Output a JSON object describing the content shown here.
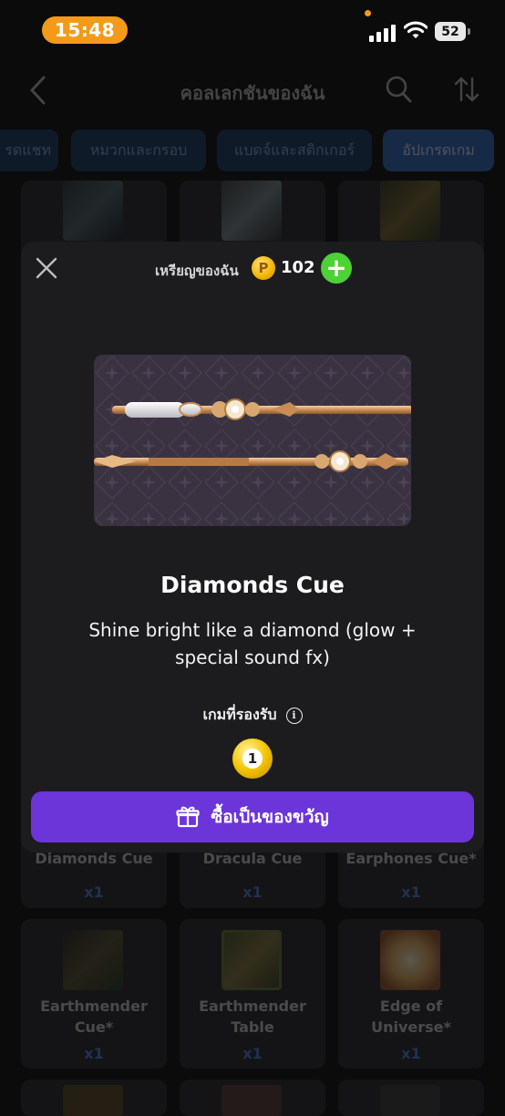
{
  "status_bar": {
    "time": "15:48",
    "battery": "52",
    "icons": [
      "signal-icon",
      "wifi-icon",
      "battery-icon"
    ]
  },
  "header": {
    "title": "คอลเลกชันของฉัน",
    "icons": [
      "back-icon",
      "search-icon",
      "sort-icon"
    ]
  },
  "tabs": [
    {
      "label": "รดแชท"
    },
    {
      "label": "หมวกและกรอบ"
    },
    {
      "label": "แบดจ์และสติกเกอร์"
    },
    {
      "label": "อัปเกรดเกม",
      "active": true
    }
  ],
  "grid": {
    "row2": [
      {
        "name": "Diamonds Cue",
        "qty": "x1"
      },
      {
        "name": "Dracula Cue",
        "qty": "x1"
      },
      {
        "name": "Earphones Cue*",
        "qty": "x1"
      }
    ],
    "row3": [
      {
        "name": "Earthmender Cue*",
        "qty": "x1"
      },
      {
        "name": "Earthmender Table",
        "qty": "x1"
      },
      {
        "name": "Edge of Universe*",
        "qty": "x1"
      }
    ]
  },
  "modal": {
    "coins_label": "เหรียญของฉัน",
    "coin_symbol": "P",
    "coin_count": "102",
    "add_symbol": "+",
    "item_title": "Diamonds Cue",
    "item_description": "Shine bright like a diamond (glow + special sound fx)",
    "supported_games_label": "เกมที่รองรับ",
    "info_symbol": "i",
    "game_ball_number": "1",
    "gift_button_label": "ซื้อเป็นของขวัญ"
  },
  "colors": {
    "accent_purple": "#6c35d9",
    "time_pill": "#f39a1a",
    "coin_gold": "#f2b300",
    "add_green": "#4cd137",
    "qty_blue": "#4d86d9"
  }
}
